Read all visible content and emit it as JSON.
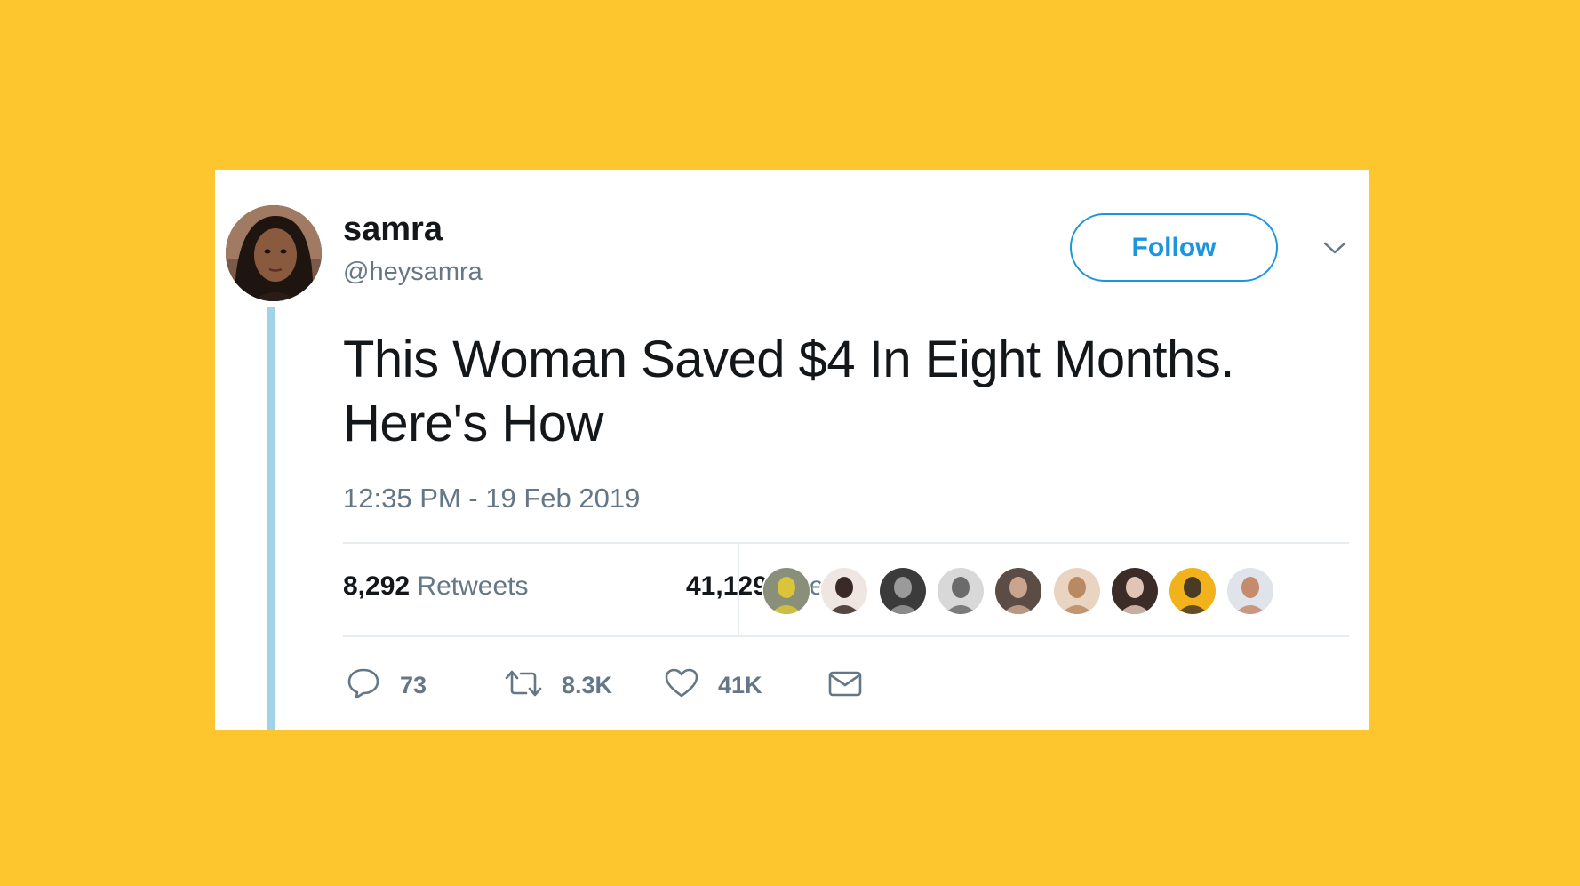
{
  "tweet": {
    "author_name": "samra",
    "author_handle": "@heysamra",
    "follow_label": "Follow",
    "text_line1": "This Woman Saved $4 In Eight Months.",
    "text_line2": "Here's How",
    "timestamp": "12:35 PM - 19 Feb 2019"
  },
  "stats": {
    "retweets_count": "8,292",
    "retweets_label": "Retweets",
    "likes_count": "41,129",
    "likes_label": "Likes"
  },
  "likers": [
    {
      "name": "liker-1",
      "bg": "#8a8f7a",
      "fg": "#d9c43a"
    },
    {
      "name": "liker-2",
      "bg": "#efe6e1",
      "fg": "#3a2a26"
    },
    {
      "name": "liker-3",
      "bg": "#3b3b3b",
      "fg": "#9a9a9a"
    },
    {
      "name": "liker-4",
      "bg": "#d8d8d8",
      "fg": "#6b6b6b"
    },
    {
      "name": "liker-5",
      "bg": "#5b4d46",
      "fg": "#c9a58e"
    },
    {
      "name": "liker-6",
      "bg": "#e8d4c1",
      "fg": "#b98a62"
    },
    {
      "name": "liker-7",
      "bg": "#3b2c28",
      "fg": "#e0c5b6"
    },
    {
      "name": "liker-8",
      "bg": "#f1b21c",
      "fg": "#4a3b27"
    },
    {
      "name": "liker-9",
      "bg": "#dfe3ea",
      "fg": "#c58b6e"
    }
  ],
  "actions": {
    "reply_count": "73",
    "retweet_count": "8.3K",
    "like_count": "41K"
  },
  "icons": {
    "reply": "reply-icon",
    "retweet": "retweet-icon",
    "like": "heart-icon",
    "dm": "envelope-icon",
    "menu": "chevron-down-icon"
  },
  "colors": {
    "background": "#FEC62E",
    "card": "#FFFFFF",
    "accent": "#1B95E0",
    "thread_line": "#A2D2E8",
    "text_primary": "#14171A",
    "text_secondary": "#657786"
  }
}
